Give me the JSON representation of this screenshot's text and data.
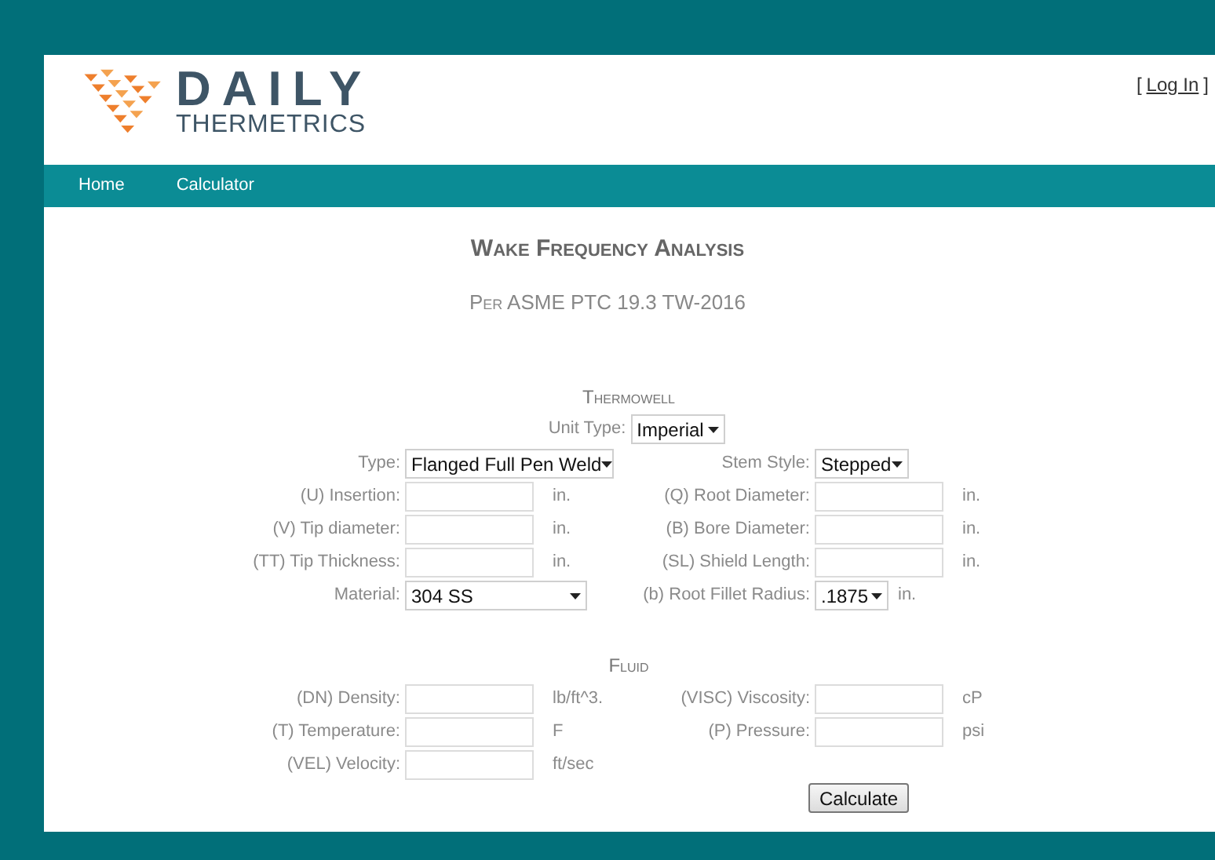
{
  "header": {
    "logo_top": "DAILY",
    "logo_bottom": "THERMETRICS",
    "login": {
      "open": "[",
      "link": "Log In",
      "close": "]"
    }
  },
  "nav": [
    "Home",
    "Calculator"
  ],
  "title": "Wake Frequency Analysis",
  "subtitle": "Per ASME PTC 19.3 TW-2016",
  "sections": [
    {
      "heading": "Thermowell",
      "unit_type": {
        "label": "Unit Type:",
        "value": "Imperial"
      },
      "rows": [
        [
          {
            "kind": "select",
            "label": "Type:",
            "value": "Flanged Full Pen Weld"
          },
          {
            "kind": "select",
            "label": "Stem Style:",
            "value": "Stepped"
          }
        ],
        [
          {
            "kind": "input",
            "label": "(U) Insertion:",
            "unit": "in."
          },
          {
            "kind": "input",
            "label": "(Q) Root Diameter:",
            "unit": "in."
          }
        ],
        [
          {
            "kind": "input",
            "label": "(V) Tip diameter:",
            "unit": "in."
          },
          {
            "kind": "input",
            "label": "(B) Bore Diameter:",
            "unit": "in."
          }
        ],
        [
          {
            "kind": "input",
            "label": "(TT) Tip Thickness:",
            "unit": "in."
          },
          {
            "kind": "input",
            "label": "(SL) Shield Length:",
            "unit": "in."
          }
        ],
        [
          {
            "kind": "select",
            "label": "Material:",
            "value": "304 SS"
          },
          {
            "kind": "select",
            "label": "(b) Root Fillet Radius:",
            "value": ".1875",
            "unit": "in."
          }
        ]
      ]
    },
    {
      "heading": "Fluid",
      "rows": [
        [
          {
            "kind": "input",
            "label": "(DN) Density:",
            "unit": "lb/ft^3."
          },
          {
            "kind": "input",
            "label": "(VISC) Viscosity:",
            "unit": "cP"
          }
        ],
        [
          {
            "kind": "input",
            "label": "(T) Temperature:",
            "unit": "F"
          },
          {
            "kind": "input",
            "label": "(P) Pressure:",
            "unit": "psi"
          }
        ],
        [
          {
            "kind": "input",
            "label": "(VEL) Velocity:",
            "unit": "ft/sec"
          },
          null
        ]
      ]
    }
  ],
  "button": "Calculate"
}
